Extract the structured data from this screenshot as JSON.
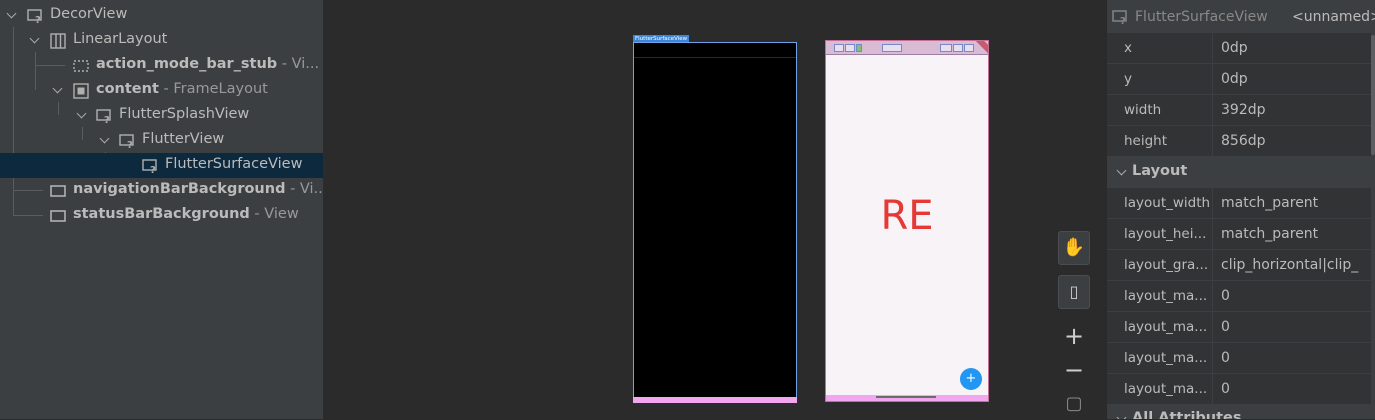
{
  "tree": {
    "nodes": [
      {
        "name": "DecorView",
        "sep": "",
        "type": "",
        "bold": false,
        "icon": "view-unknown-icon"
      },
      {
        "name": "LinearLayout",
        "sep": "",
        "type": "",
        "bold": false,
        "icon": "linear-layout-icon"
      },
      {
        "name": "action_mode_bar_stub",
        "sep": " - ",
        "type": "Vi...",
        "bold": true,
        "icon": "view-stub-icon"
      },
      {
        "name": "content",
        "sep": " - ",
        "type": "FrameLayout",
        "bold": true,
        "icon": "frame-layout-icon"
      },
      {
        "name": "FlutterSplashView",
        "sep": "",
        "type": "",
        "bold": false,
        "icon": "view-unknown-icon"
      },
      {
        "name": "FlutterView",
        "sep": "",
        "type": "",
        "bold": false,
        "icon": "view-unknown-icon"
      },
      {
        "name": "FlutterSurfaceView",
        "sep": "",
        "type": "",
        "bold": false,
        "icon": "view-unknown-icon"
      },
      {
        "name": "navigationBarBackground",
        "sep": " - ",
        "type": "Vi...",
        "bold": true,
        "icon": "view-icon"
      },
      {
        "name": "statusBarBackground",
        "sep": " - ",
        "type": "View",
        "bold": true,
        "icon": "view-icon"
      }
    ]
  },
  "canvas": {
    "frame_tag": "FlutterSurfaceView",
    "device_text": "RE",
    "fab_label": "+"
  },
  "toolbar": {
    "pan": "✋",
    "toggle": "▯",
    "zoom_in": "+",
    "zoom_out": "−",
    "fit": "▢"
  },
  "attributes": {
    "header_type": "FlutterSurfaceView",
    "header_id": "<unnamed>",
    "dimensions": [
      {
        "key": "x",
        "value": "0dp"
      },
      {
        "key": "y",
        "value": "0dp"
      },
      {
        "key": "width",
        "value": "392dp"
      },
      {
        "key": "height",
        "value": "856dp"
      }
    ],
    "layout_section": "Layout",
    "layout": [
      {
        "key": "layout_width",
        "value": "match_parent"
      },
      {
        "key": "layout_hei...",
        "value": "match_parent"
      },
      {
        "key": "layout_gra...",
        "value": "clip_horizontal|clip_"
      },
      {
        "key": "layout_ma...",
        "value": "0"
      },
      {
        "key": "layout_ma...",
        "value": "0"
      },
      {
        "key": "layout_ma...",
        "value": "0"
      },
      {
        "key": "layout_ma...",
        "value": "0"
      }
    ],
    "all_section": "All Attributes"
  },
  "colors": {
    "selected_row": "#0d293e",
    "accent_blue": "#3d85d8",
    "device_text": "#e53935",
    "fab": "#2196f3"
  }
}
